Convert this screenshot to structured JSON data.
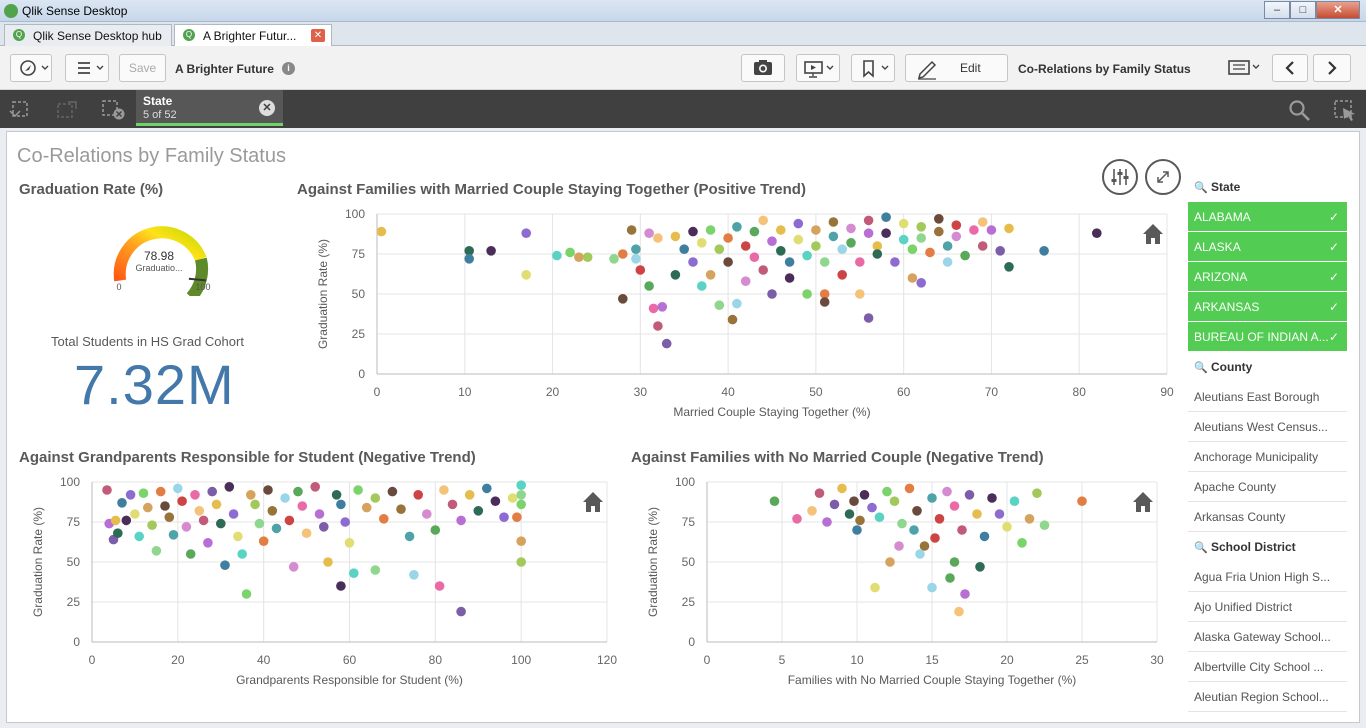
{
  "window": {
    "title": "Qlik Sense Desktop"
  },
  "tabs": [
    {
      "label": "Qlik Sense Desktop hub"
    },
    {
      "label": "A Brighter Futur..."
    }
  ],
  "toolbar": {
    "save_label": "Save",
    "app_name": "A Brighter Future",
    "edit_label": "Edit",
    "sheet_name": "Co-Relations by Family Status"
  },
  "selections": {
    "field": "State",
    "count": "5 of 52"
  },
  "sheet": {
    "title": "Co-Relations by Family Status"
  },
  "gauge": {
    "title": "Graduation Rate (%)",
    "value": 78.98,
    "value_text": "78.98",
    "label": "Graduatio...",
    "min_label": "0",
    "max_label": "100",
    "min": 0,
    "max": 100
  },
  "kpi": {
    "label": "Total Students in HS Grad Cohort",
    "value": "7.32M"
  },
  "filters": {
    "state": {
      "title": "State",
      "items": [
        "ALABAMA",
        "ALASKA",
        "ARIZONA",
        "ARKANSAS",
        "BUREAU OF INDIAN A..."
      ]
    },
    "county": {
      "title": "County",
      "items": [
        "Aleutians East Borough",
        "Aleutians West Census...",
        "Anchorage Municipality",
        "Apache County",
        "Arkansas County"
      ]
    },
    "district": {
      "title": "School District",
      "items": [
        "Agua Fria Union High S...",
        "Ajo Unified District",
        "Alaska Gateway School...",
        "Albertville City School ...",
        "Aleutian Region School..."
      ]
    }
  },
  "chart_data": [
    {
      "type": "scatter",
      "title": "Against Families with Married Couple Staying Together (Positive Trend)",
      "xlabel": "Married Couple Staying Together (%)",
      "ylabel": "Graduation Rate (%)",
      "xlim": [
        0,
        90
      ],
      "ylim": [
        0,
        100
      ],
      "xticks": [
        "0",
        "10",
        "20",
        "30",
        "40",
        "50",
        "60",
        "70",
        "80",
        "90"
      ],
      "yticks": [
        "0",
        "25",
        "50",
        "75",
        "100"
      ],
      "grid": true,
      "points": [
        [
          0.5,
          89
        ],
        [
          10.5,
          77
        ],
        [
          10.5,
          72
        ],
        [
          13,
          77
        ],
        [
          17,
          88
        ],
        [
          17,
          62
        ],
        [
          20.5,
          74
        ],
        [
          22,
          76
        ],
        [
          23,
          73
        ],
        [
          24,
          73
        ],
        [
          27,
          72
        ],
        [
          28,
          75
        ],
        [
          28,
          47
        ],
        [
          29,
          90
        ],
        [
          29.5,
          78
        ],
        [
          29.5,
          72
        ],
        [
          30,
          65
        ],
        [
          31,
          88
        ],
        [
          31,
          55
        ],
        [
          31.5,
          41
        ],
        [
          32,
          85
        ],
        [
          32,
          30
        ],
        [
          32.5,
          42
        ],
        [
          33,
          19
        ],
        [
          34,
          86
        ],
        [
          34,
          62
        ],
        [
          35,
          78
        ],
        [
          36,
          89
        ],
        [
          36,
          70
        ],
        [
          37,
          82
        ],
        [
          37,
          55
        ],
        [
          38,
          90
        ],
        [
          38,
          62
        ],
        [
          39,
          78
        ],
        [
          39,
          43
        ],
        [
          40,
          85
        ],
        [
          40,
          70
        ],
        [
          40.5,
          34
        ],
        [
          41,
          92
        ],
        [
          41,
          44
        ],
        [
          42,
          80
        ],
        [
          42,
          58
        ],
        [
          43,
          89
        ],
        [
          43,
          73
        ],
        [
          44,
          96
        ],
        [
          44,
          65
        ],
        [
          45,
          83
        ],
        [
          45,
          50
        ],
        [
          46,
          90
        ],
        [
          46,
          77
        ],
        [
          47,
          70
        ],
        [
          47,
          60
        ],
        [
          48,
          94
        ],
        [
          48,
          84
        ],
        [
          49,
          74
        ],
        [
          49,
          50
        ],
        [
          50,
          90
        ],
        [
          50,
          80
        ],
        [
          51,
          70
        ],
        [
          51,
          50
        ],
        [
          51,
          45
        ],
        [
          52,
          95
        ],
        [
          52,
          86
        ],
        [
          53,
          78
        ],
        [
          53,
          62
        ],
        [
          54,
          91
        ],
        [
          54,
          82
        ],
        [
          55,
          70
        ],
        [
          55,
          50
        ],
        [
          56,
          96
        ],
        [
          56,
          88
        ],
        [
          56,
          35
        ],
        [
          57,
          80
        ],
        [
          57,
          75
        ],
        [
          58,
          98
        ],
        [
          58,
          88
        ],
        [
          59,
          70
        ],
        [
          60,
          94
        ],
        [
          60,
          84
        ],
        [
          61,
          78
        ],
        [
          61,
          60
        ],
        [
          62,
          92
        ],
        [
          62,
          85
        ],
        [
          63,
          76
        ],
        [
          64,
          97
        ],
        [
          64,
          89
        ],
        [
          65,
          80
        ],
        [
          65,
          70
        ],
        [
          66,
          93
        ],
        [
          66,
          86
        ],
        [
          67,
          74
        ],
        [
          68,
          90
        ],
        [
          69,
          95
        ],
        [
          69,
          80
        ],
        [
          70,
          90
        ],
        [
          71,
          77
        ],
        [
          72,
          91
        ],
        [
          72,
          67
        ],
        [
          76,
          77
        ],
        [
          82,
          88
        ],
        [
          62,
          57
        ]
      ]
    },
    {
      "type": "scatter",
      "title": "Against Grandparents Responsible for Student (Negative Trend)",
      "xlabel": "Grandparents Responsible for Student (%)",
      "ylabel": "Graduation Rate (%)",
      "xlim": [
        0,
        120
      ],
      "ylim": [
        0,
        100
      ],
      "xticks": [
        "0",
        "20",
        "40",
        "60",
        "80",
        "100",
        "120"
      ],
      "yticks": [
        "0",
        "25",
        "50",
        "75",
        "100"
      ],
      "grid": true,
      "points": [
        [
          3.5,
          95
        ],
        [
          4,
          74
        ],
        [
          5,
          64
        ],
        [
          5.5,
          76
        ],
        [
          6,
          68
        ],
        [
          7,
          87
        ],
        [
          8,
          76
        ],
        [
          9,
          92
        ],
        [
          10,
          80
        ],
        [
          11,
          66
        ],
        [
          12,
          93
        ],
        [
          13,
          84
        ],
        [
          14,
          73
        ],
        [
          15,
          57
        ],
        [
          16,
          94
        ],
        [
          17,
          85
        ],
        [
          18,
          78
        ],
        [
          19,
          67
        ],
        [
          20,
          96
        ],
        [
          21,
          88
        ],
        [
          22,
          72
        ],
        [
          23,
          55
        ],
        [
          24,
          92
        ],
        [
          25,
          82
        ],
        [
          26,
          76
        ],
        [
          27,
          62
        ],
        [
          28,
          94
        ],
        [
          29,
          86
        ],
        [
          30,
          74
        ],
        [
          31,
          48
        ],
        [
          32,
          97
        ],
        [
          33,
          80
        ],
        [
          34,
          66
        ],
        [
          35,
          55
        ],
        [
          36,
          30
        ],
        [
          37,
          92
        ],
        [
          38,
          86
        ],
        [
          39,
          74
        ],
        [
          40,
          63
        ],
        [
          41,
          95
        ],
        [
          42,
          82
        ],
        [
          43,
          71
        ],
        [
          45,
          90
        ],
        [
          46,
          76
        ],
        [
          47,
          47
        ],
        [
          48,
          94
        ],
        [
          49,
          85
        ],
        [
          50,
          68
        ],
        [
          52,
          97
        ],
        [
          53,
          80
        ],
        [
          54,
          72
        ],
        [
          55,
          50
        ],
        [
          57,
          92
        ],
        [
          58,
          86
        ],
        [
          58,
          35
        ],
        [
          59,
          75
        ],
        [
          60,
          62
        ],
        [
          61,
          43
        ],
        [
          62,
          95
        ],
        [
          64,
          84
        ],
        [
          66,
          90
        ],
        [
          66,
          45
        ],
        [
          68,
          77
        ],
        [
          70,
          94
        ],
        [
          72,
          83
        ],
        [
          74,
          66
        ],
        [
          75,
          42
        ],
        [
          76,
          92
        ],
        [
          78,
          80
        ],
        [
          80,
          70
        ],
        [
          81,
          35
        ],
        [
          82,
          95
        ],
        [
          84,
          86
        ],
        [
          86,
          76
        ],
        [
          86,
          19
        ],
        [
          88,
          92
        ],
        [
          90,
          82
        ],
        [
          92,
          96
        ],
        [
          94,
          88
        ],
        [
          96,
          78
        ],
        [
          98,
          90
        ],
        [
          100,
          98
        ],
        [
          100,
          86
        ],
        [
          100,
          63
        ],
        [
          100,
          50
        ],
        [
          100,
          92
        ],
        [
          99,
          78
        ]
      ]
    },
    {
      "type": "scatter",
      "title": "Against Families with No Married Couple (Negative Trend)",
      "xlabel": "Families with No Married Couple Staying Together (%)",
      "ylabel": "Graduation Rate (%)",
      "xlim": [
        0,
        30
      ],
      "ylim": [
        0,
        100
      ],
      "xticks": [
        "0",
        "5",
        "10",
        "15",
        "20",
        "25",
        "30"
      ],
      "yticks": [
        "0",
        "25",
        "50",
        "75",
        "100"
      ],
      "grid": true,
      "points": [
        [
          4.5,
          88
        ],
        [
          6,
          77
        ],
        [
          7,
          82
        ],
        [
          7.5,
          93
        ],
        [
          8,
          75
        ],
        [
          8.5,
          86
        ],
        [
          9,
          96
        ],
        [
          9.5,
          80
        ],
        [
          10,
          70
        ],
        [
          10.5,
          92
        ],
        [
          11,
          84
        ],
        [
          11.2,
          34
        ],
        [
          11.5,
          78
        ],
        [
          12,
          94
        ],
        [
          12.2,
          50
        ],
        [
          12.5,
          88
        ],
        [
          13,
          74
        ],
        [
          13.5,
          96
        ],
        [
          14,
          82
        ],
        [
          14.5,
          60
        ],
        [
          15,
          90
        ],
        [
          15,
          34
        ],
        [
          15.5,
          77
        ],
        [
          16,
          94
        ],
        [
          16.2,
          40
        ],
        [
          16.5,
          85
        ],
        [
          16.8,
          19
        ],
        [
          17,
          70
        ],
        [
          17.2,
          30
        ],
        [
          17.5,
          92
        ],
        [
          18,
          80
        ],
        [
          18.2,
          47
        ],
        [
          18.5,
          66
        ],
        [
          19,
          90
        ],
        [
          19.5,
          80
        ],
        [
          20,
          72
        ],
        [
          20.5,
          88
        ],
        [
          21,
          62
        ],
        [
          21.5,
          77
        ],
        [
          22,
          93
        ],
        [
          22.5,
          73
        ],
        [
          25,
          88
        ],
        [
          9.8,
          88
        ],
        [
          10.2,
          76
        ],
        [
          13.8,
          70
        ],
        [
          14.2,
          55
        ],
        [
          15.2,
          65
        ],
        [
          12.8,
          60
        ],
        [
          16.5,
          50
        ]
      ]
    }
  ]
}
